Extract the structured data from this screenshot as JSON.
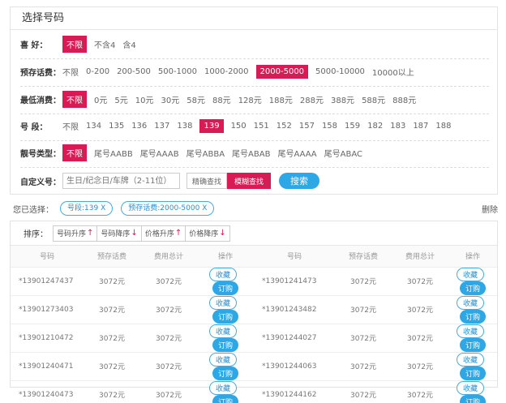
{
  "panel": {
    "title": "选择号码"
  },
  "filters": {
    "lucky": {
      "label": "喜 好：",
      "options": [
        "不限",
        "不含4",
        "含4"
      ],
      "selected": 0
    },
    "prestore": {
      "label": "预存话费：",
      "options": [
        "不限",
        "0-200",
        "200-500",
        "500-1000",
        "1000-2000",
        "2000-5000",
        "5000-10000",
        "10000以上"
      ],
      "selected": 5
    },
    "min_consume": {
      "label": "最低消费：",
      "options": [
        "不限",
        "0元",
        "5元",
        "10元",
        "30元",
        "58元",
        "88元",
        "128元",
        "188元",
        "288元",
        "388元",
        "588元",
        "888元"
      ],
      "selected": 0
    },
    "segment": {
      "label": "号 段：",
      "options": [
        "不限",
        "134",
        "135",
        "136",
        "137",
        "138",
        "139",
        "150",
        "151",
        "152",
        "157",
        "158",
        "159",
        "182",
        "183",
        "187",
        "188"
      ],
      "selected": 6
    },
    "pattern": {
      "label": "靓号类型：",
      "options": [
        "不限",
        "尾号AABB",
        "尾号AAAB",
        "尾号ABBA",
        "尾号ABAB",
        "尾号AAAA",
        "尾号ABAC"
      ],
      "selected": 0
    },
    "custom": {
      "label": "自定义号：",
      "placeholder": "生日/纪念日/车牌（2-11位）",
      "exact_label": "精确查找",
      "fuzzy_label": "模糊查找",
      "search_label": "搜索"
    }
  },
  "selected_bar": {
    "label": "您已选择：",
    "chips": [
      "号段:139 X",
      "预存话费:2000-5000 X"
    ],
    "delete_label": "删除"
  },
  "sort": {
    "label": "排序：",
    "buttons": [
      "号码升序",
      "号码降序",
      "价格升序",
      "价格降序"
    ]
  },
  "table": {
    "headers": [
      "号码",
      "预存话费",
      "费用总计",
      "操作",
      "号码",
      "预存话费",
      "费用总计",
      "操作"
    ],
    "fav_label": "收藏",
    "order_label": "订购",
    "rows": [
      {
        "left": [
          "*13901247437",
          "3072元",
          "3072元"
        ],
        "right": [
          "*13901241473",
          "3072元",
          "3072元"
        ]
      },
      {
        "left": [
          "*13901273403",
          "3072元",
          "3072元"
        ],
        "right": [
          "*13901243482",
          "3072元",
          "3072元"
        ]
      },
      {
        "left": [
          "*13901210472",
          "3072元",
          "3072元"
        ],
        "right": [
          "*13901244027",
          "3072元",
          "3072元"
        ]
      },
      {
        "left": [
          "*13901240471",
          "3072元",
          "3072元"
        ],
        "right": [
          "*13901244063",
          "3072元",
          "3072元"
        ]
      },
      {
        "left": [
          "*13901240473",
          "3072元",
          "3072元"
        ],
        "right": [
          "*13901244162",
          "3072元",
          "3072元"
        ]
      }
    ]
  },
  "colors": {
    "accent": "#d81b55",
    "blue": "#2ea7e6"
  }
}
